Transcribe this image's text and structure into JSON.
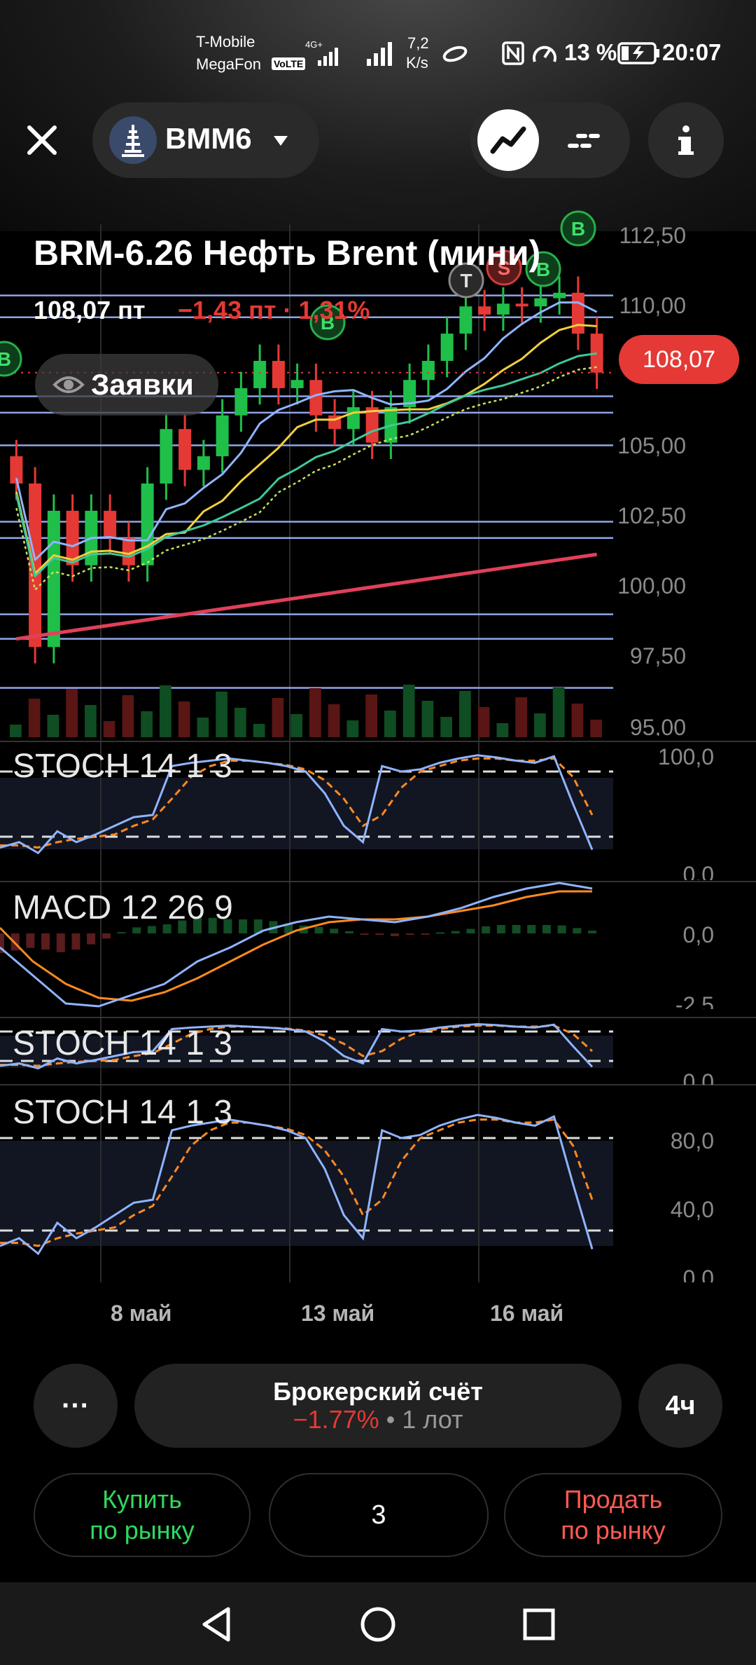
{
  "status_bar": {
    "carrier1": "T-Mobile",
    "carrier2": "MegaFon",
    "volte": "VoLTE",
    "net_type": "4G+",
    "speed_value": "7,2",
    "speed_unit": "K/s",
    "battery": "13 %",
    "time": "20:07"
  },
  "header": {
    "ticker": "BMM6",
    "ticker_icon": "oil-rig-icon",
    "close_icon": "close-icon",
    "dropdown_icon": "chevron-down-icon",
    "chart_mode_icon": "line-chart-icon",
    "orderbook_icon": "order-book-icon",
    "info_icon": "info-icon"
  },
  "instrument": {
    "title": "BRM-6.26 Нефть Brent (мини)",
    "price": "108,07 пт",
    "change": "−1,43 пт · 1,31%",
    "price_badge": "108,07",
    "orders_label": "Заявки"
  },
  "colors": {
    "up": "#1fbf4a",
    "down": "#e53935",
    "level_line": "#8fa6e8",
    "stoch_k": "#8fb4ff",
    "stoch_d": "#ff8a1f",
    "sma_red": "#e0405a",
    "sma_green": "#3ec99a",
    "sma_yellow": "#f2d03a",
    "sma_blue": "#8fb4ff"
  },
  "trade_markers": [
    {
      "label": "B",
      "color": "green"
    },
    {
      "label": "B",
      "color": "green"
    },
    {
      "label": "B",
      "color": "green"
    },
    {
      "label": "S",
      "color": "red"
    },
    {
      "label": "T",
      "color": "grey"
    },
    {
      "label": "B",
      "color": "green"
    }
  ],
  "indicators": {
    "stoch1": "STOCH 14 1 3",
    "macd": "MACD 12 26 9",
    "stoch2": "STOCH 14 1 3",
    "stoch3": "STOCH 14 1 3"
  },
  "chart_data": {
    "type": "candlestick",
    "title": "BRM-6.26 Нефть Brent (мини)",
    "price_axis": [
      "112,50",
      "110,00",
      "107,50",
      "105,00",
      "102,50",
      "100,00",
      "97,50",
      "95,00"
    ],
    "ylim": [
      95.0,
      113.0
    ],
    "date_ticks": [
      "8 май",
      "13 май",
      "16 май"
    ],
    "level_lines": [
      110.9,
      110.1,
      107.2,
      106.6,
      105.4,
      102.6,
      102.0,
      99.2,
      98.3,
      96.5
    ],
    "closes": [
      104,
      98,
      103,
      101,
      103,
      102,
      101,
      104,
      106,
      104.5,
      105,
      106.5,
      107.5,
      108.5,
      107.5,
      107.8,
      106.5,
      106,
      106.8,
      105.5,
      106.8,
      107.8,
      108.5,
      109.5,
      110.5,
      110.2,
      110.6,
      110.5,
      110.8,
      111,
      109.5,
      108.07
    ],
    "last_price": 108.07,
    "stoch1_axis": [
      "100,0",
      "0,0"
    ],
    "macd_axis": [
      "0,0",
      "-2,5"
    ],
    "stoch2_axis": [
      "0,0"
    ],
    "stoch3_axis": [
      "80,0",
      "40,0",
      "0,0"
    ],
    "stoch_k": [
      10,
      15,
      5,
      25,
      15,
      22,
      30,
      38,
      40,
      85,
      88,
      90,
      92,
      90,
      88,
      85,
      80,
      60,
      30,
      15,
      85,
      80,
      82,
      88,
      92,
      95,
      93,
      90,
      88,
      94,
      50,
      8
    ],
    "stoch_d": [
      12,
      12,
      10,
      15,
      18,
      20,
      22,
      30,
      36,
      55,
      75,
      85,
      90,
      90,
      88,
      86,
      82,
      72,
      55,
      30,
      40,
      65,
      80,
      85,
      90,
      92,
      92,
      90,
      90,
      92,
      75,
      40
    ],
    "macd_line": [
      -0.5,
      -1.5,
      -2.5,
      -2.6,
      -2.2,
      -1.8,
      -1.0,
      -0.5,
      0.1,
      0.4,
      0.6,
      0.5,
      0.4,
      0.6,
      0.9,
      1.3,
      1.6,
      1.8,
      1.6
    ],
    "macd_signal": [
      0.2,
      -1.0,
      -1.8,
      -2.3,
      -2.4,
      -2.1,
      -1.6,
      -1.0,
      -0.4,
      0.1,
      0.4,
      0.5,
      0.5,
      0.6,
      0.8,
      1.0,
      1.3,
      1.5,
      1.5
    ]
  },
  "bottom": {
    "more_label": "···",
    "account_label": "Брокерский счёт",
    "account_change": "−1.77%",
    "account_lots": "• 1 лот",
    "timeframe": "4ч",
    "buy_line1": "Купить",
    "buy_line2": "по рынку",
    "quantity": "3",
    "sell_line1": "Продать",
    "sell_line2": "по рынку"
  },
  "navbar": {
    "back_icon": "back-triangle-icon",
    "home_icon": "home-circle-icon",
    "recent_icon": "recent-square-icon"
  }
}
